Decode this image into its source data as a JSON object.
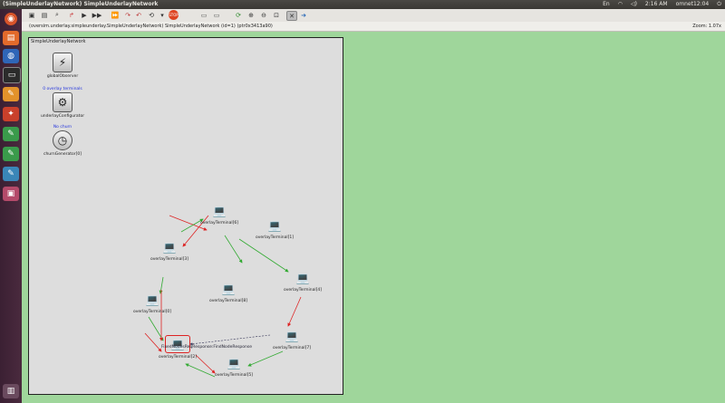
{
  "window": {
    "title": "(SimpleUnderlayNetwork) SimpleUnderlayNetwork"
  },
  "tray": {
    "keyboard": "En",
    "time": "2:16 AM",
    "user": "omnet12:04"
  },
  "pathbar": {
    "path": "(oversim.underlay.simpleunderlay.SimpleUnderlayNetwork) SimpleUnderlayNetwork (id=1) (ptr0x3413a90)",
    "zoom": "Zoom: 1.07x"
  },
  "network": {
    "label": "SimpleUnderlayNetwork",
    "modules": [
      {
        "name": "globalObserver",
        "status": "",
        "icon": "globe-icon"
      },
      {
        "name": "underlayConfigurator",
        "status": "0 overlay terminals",
        "icon": "gear-icon"
      },
      {
        "name": "churnGenerator[0]",
        "status": "No churn",
        "icon": "clock-icon"
      }
    ],
    "terminals": [
      {
        "name": "overlayTerminal[6]"
      },
      {
        "name": "overlayTerminal[1]"
      },
      {
        "name": "overlayTerminal[3]"
      },
      {
        "name": "overlayTerminal[4]"
      },
      {
        "name": "overlayTerminal[8]"
      },
      {
        "name": "overlayTerminal[0]"
      },
      {
        "name": "overlayTerminal[7]"
      },
      {
        "name": "overlayTerminal[2]"
      },
      {
        "name": "overlayTerminal[5]"
      }
    ],
    "message_label": "FixedNodesReqResponse:FindNodeResponse"
  }
}
